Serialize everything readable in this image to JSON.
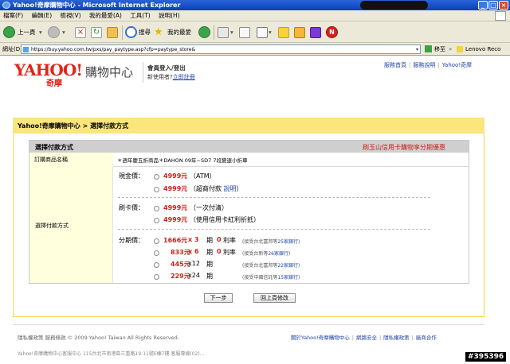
{
  "window": {
    "title": "Yahoo!奇摩購物中心 - Microsoft Internet Explorer",
    "buttons": [
      "_",
      "□",
      "×"
    ]
  },
  "menu": [
    "檔案(F)",
    "編輯(E)",
    "檢視(V)",
    "我的最愛(A)",
    "工具(T)",
    "說明(H)"
  ],
  "toolbar": {
    "back": "上一頁",
    "search": "搜尋",
    "favorites": "我的最愛"
  },
  "address": {
    "label": "網址(D)",
    "url": "https://buy.yahoo.com.tw/pxs/pay_paytype.asp?cfp=paytype_store&",
    "go": "移至",
    "links": "Lenovo Reco"
  },
  "header": {
    "logo": "YAHOO!",
    "logo_sub": "奇摩",
    "title": "購物中心",
    "login": "會員登入/登出",
    "newuser_prefix": "新使用者?",
    "register": "立即註冊",
    "toplinks": [
      "服務首頁",
      "服務說明",
      "Yahoo!奇摩"
    ]
  },
  "breadcrumb": "Yahoo!奇摩購物中心 > 選擇付款方式",
  "section": {
    "title": "選擇付款方式",
    "promo": "刷玉山信用卡購物享分期優惠",
    "product_label": "訂購商品名稱",
    "product_value": "＊週年慶五折商品＊DAHON 09年~SD7 7段變速小折車",
    "pay_label": "選擇付款方式"
  },
  "payment": {
    "cash": {
      "label": "現金價：",
      "options": [
        {
          "price": "4999元",
          "note": "（ATM）",
          "link": ""
        },
        {
          "price": "4999元",
          "note": "（超商付款",
          "link": "說明",
          "suffix": "）"
        }
      ]
    },
    "card": {
      "label": "刷卡價：",
      "options": [
        {
          "price": "4999元",
          "note": "（一次付清）"
        },
        {
          "price": "4999元",
          "note": "（使用信用卡紅利折抵）"
        }
      ]
    },
    "installment": {
      "label": "分期價：",
      "options": [
        {
          "amount": "1666元",
          "x": "x 3",
          "period": "期",
          "zero": "0",
          "rate": "利率",
          "accept": "(接受台北富邦等",
          "banks": "25家銀行",
          "end": ")"
        },
        {
          "amount": "833元",
          "x": "x 6",
          "period": "期",
          "zero": "0",
          "rate": "利率",
          "accept": "(接受台新等",
          "banks": "26家銀行",
          "end": ")"
        },
        {
          "amount": "445元",
          "x": "x12",
          "period": "期",
          "zero": "",
          "rate": "",
          "accept": "(接受台北富邦等",
          "banks": "22家銀行",
          "end": ")"
        },
        {
          "amount": "229元",
          "x": "x24",
          "period": "期",
          "zero": "",
          "rate": "",
          "accept": "(接受中國信託等",
          "banks": "15家銀行",
          "end": ")"
        }
      ]
    }
  },
  "buttons": {
    "next": "下一步",
    "back": "回上頁修改"
  },
  "footer": {
    "left": "隱私權政策  服務條款 © 2009 Yahoo! Taiwan All Rights Reserved.",
    "links": [
      "關於Yahoo!奇摩購物中心",
      "網路安全",
      "隱私權政策",
      "廠商合作"
    ],
    "address": "Yahoo!奇摩購物中心客服中心 115台北市南港區三重路19-11號E棟7樓 客服專線(02)..."
  },
  "watermark": "#395396",
  "colors": {
    "title_bar": "#0a3fb8",
    "brand_red": "#e1261c",
    "price_red": "#c9231b",
    "link_blue": "#2144a8",
    "header_yellow": "#fbe57d",
    "label_cell": "#ffffdd"
  }
}
